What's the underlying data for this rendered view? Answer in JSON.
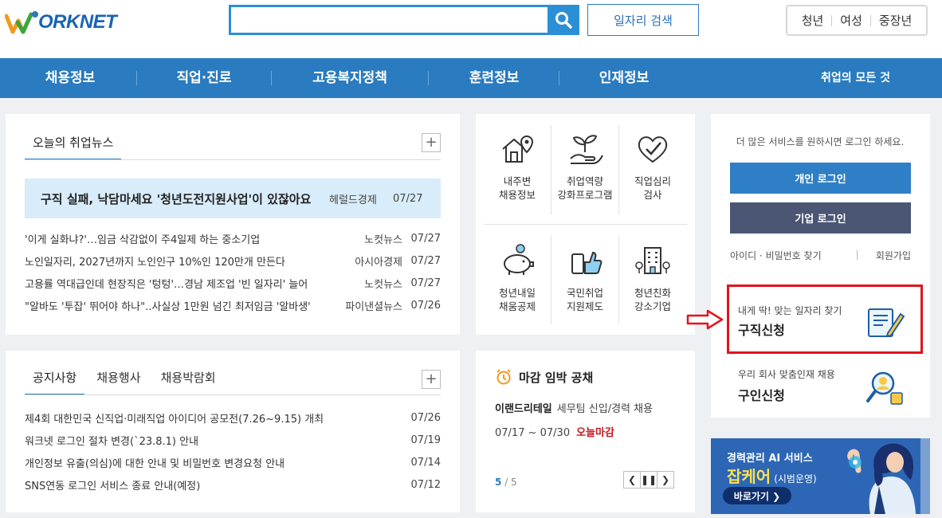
{
  "header": {
    "logo_text": "ORKNET",
    "search_placeholder": "",
    "job_search_label": "일자리 검색",
    "target_groups": [
      "청년",
      "여성",
      "중장년"
    ]
  },
  "nav": {
    "items": [
      "채용정보",
      "직업·진로",
      "고용복지정책",
      "훈련정보",
      "인재정보"
    ],
    "all_label": "취업의 모든 것"
  },
  "news": {
    "tab": "오늘의 취업뉴스",
    "plus": "+",
    "headline": {
      "title": "구직 실패, 낙담마세요 '청년도전지원사업'이 있잖아요",
      "source": "헤럴드경제",
      "date": "07/27"
    },
    "items": [
      {
        "title": "'이게 실화냐?'…임금 삭감없이 주4일제 하는 중소기업",
        "source": "노컷뉴스",
        "date": "07/27"
      },
      {
        "title": "노인일자리, 2027년까지 노인인구 10%인 120만개 만든다",
        "source": "아시아경제",
        "date": "07/27"
      },
      {
        "title": "고용률 역대급인데 현장직은 '텅텅'…경남 제조업 '빈 일자리' 늘어",
        "source": "노컷뉴스",
        "date": "07/27"
      },
      {
        "title": "\"알바도 '투잡' 뛰어야 하나\"..사실상 1만원 넘긴 최저임금 '알바생'",
        "source": "파이낸셜뉴스",
        "date": "07/26"
      }
    ]
  },
  "notice": {
    "tabs": [
      "공지사항",
      "채용행사",
      "채용박람회"
    ],
    "plus": "+",
    "items": [
      {
        "title": "제4회 대한민국 신직업·미래직업 아이디어 공모전(7.26~9.15) 개최",
        "date": "07/26"
      },
      {
        "title": "워크넷 로그인 절차 변경(`23.8.1) 안내",
        "date": "07/19"
      },
      {
        "title": "개인정보 유출(의심)에 대한 안내 및 비밀번호 변경요청 안내",
        "date": "07/14"
      },
      {
        "title": "SNS연동 로그인 서비스 종료 안내(예정)",
        "date": "07/12"
      }
    ]
  },
  "services": [
    {
      "l1": "내주변",
      "l2": "채용정보",
      "icon": "house-map-icon"
    },
    {
      "l1": "취업역량",
      "l2": "강화프로그램",
      "icon": "sprout-hand-icon"
    },
    {
      "l1": "직업심리",
      "l2": "검사",
      "icon": "heart-check-icon"
    },
    {
      "l1": "청년내일",
      "l2": "채움공제",
      "icon": "piggy-bank-icon"
    },
    {
      "l1": "국민취업",
      "l2": "지원제도",
      "icon": "phone-thumbs-up-icon"
    },
    {
      "l1": "청년친화",
      "l2": "강소기업",
      "icon": "building-icon"
    }
  ],
  "deadline": {
    "title": "마감 임박 공채",
    "company": "이랜드리테일",
    "job": "세무팀 신입/경력 채용",
    "period": "07/17 ~ 07/30",
    "today": "오늘마감",
    "page_current": "5",
    "page_total": "/ 5"
  },
  "login": {
    "message": "더 많은 서비스를 원하시면 로그인 하세요.",
    "personal": "개인 로그인",
    "company": "기업 로그인",
    "find": "아이디 · 비밀번호 찾기",
    "join": "회원가입"
  },
  "cards": {
    "apply_sub": "내게 딱! 맞는 일자리 찾기",
    "apply_title": "구직신청",
    "hire_sub": "우리 회사 맞춤인재 채용",
    "hire_title": "구인신청"
  },
  "banner": {
    "line1": "경력관리 AI 서비스",
    "line2": "잡케어",
    "line2_sub": "(시범운영)",
    "button": "바로가기 ❯"
  },
  "colors": {
    "primary": "#2a7bc0",
    "navy": "#4a5673",
    "highlight": "#e1141d",
    "headline_bg": "#d8ecfa"
  }
}
